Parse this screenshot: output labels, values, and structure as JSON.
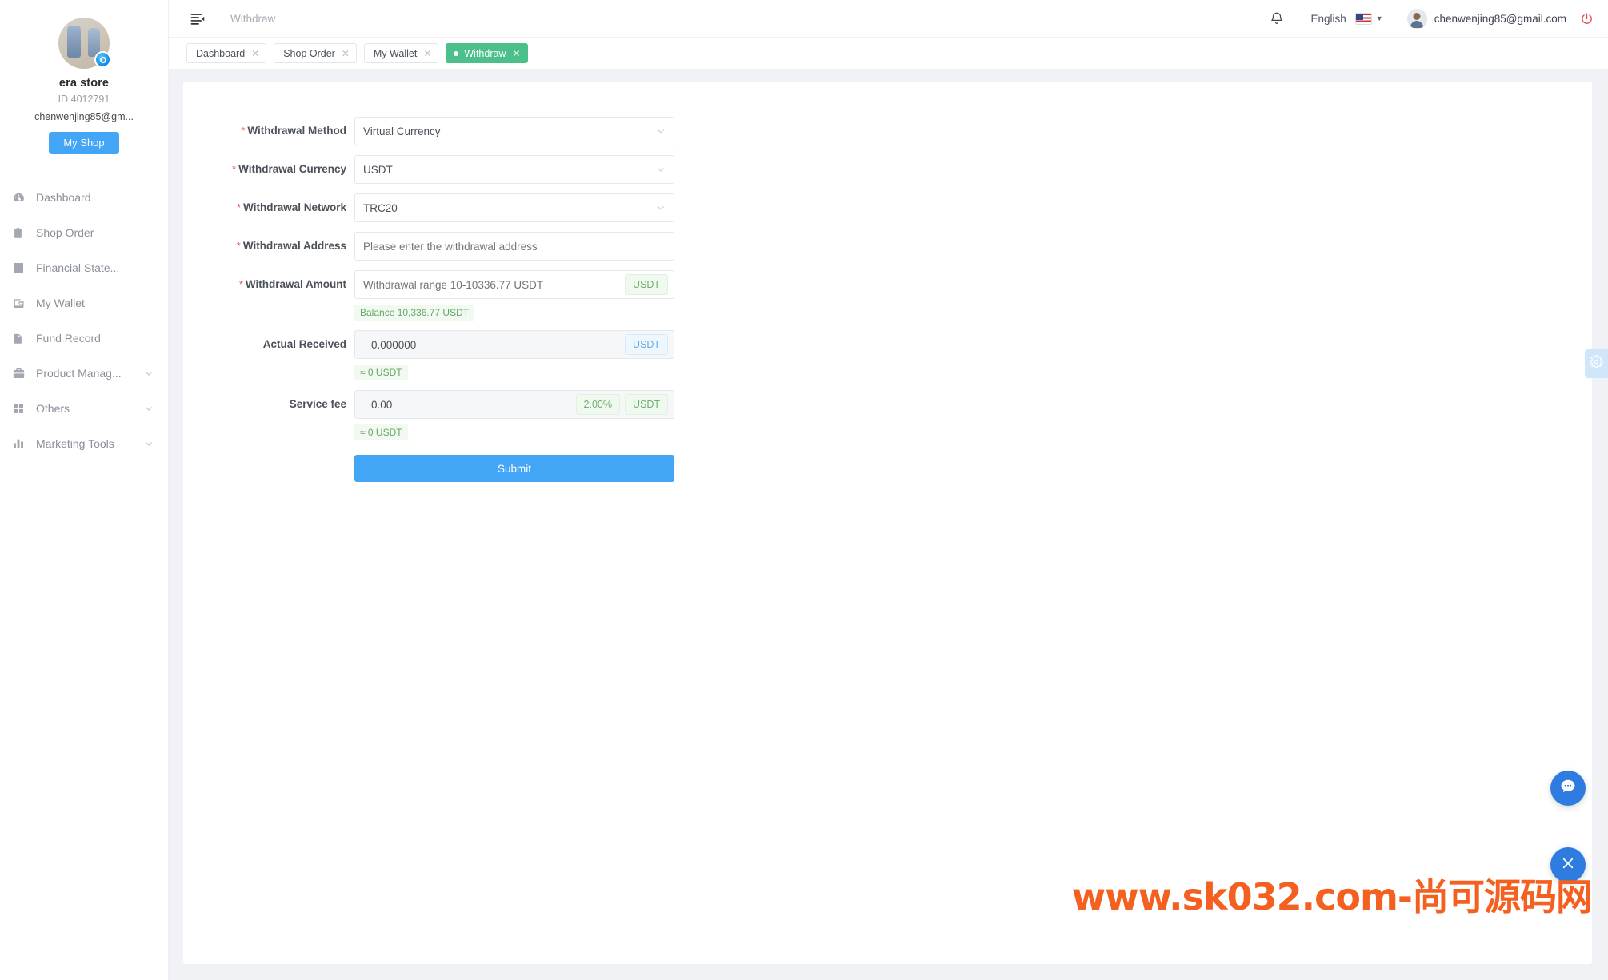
{
  "sidebar": {
    "profile": {
      "store_name": "era store",
      "store_id": "ID 4012791",
      "email": "chenwenjing85@gm...",
      "shop_button": "My Shop"
    },
    "items": [
      {
        "label": "Dashboard",
        "icon": "dashboard-icon",
        "caret": false
      },
      {
        "label": "Shop Order",
        "icon": "clipboard-icon",
        "caret": false
      },
      {
        "label": "Financial State...",
        "icon": "chart-report-icon",
        "caret": false
      },
      {
        "label": "My Wallet",
        "icon": "wallet-icon",
        "caret": false
      },
      {
        "label": "Fund Record",
        "icon": "document-icon",
        "caret": false
      },
      {
        "label": "Product Manag...",
        "icon": "briefcase-icon",
        "caret": true
      },
      {
        "label": "Others",
        "icon": "grid-icon",
        "caret": true
      },
      {
        "label": "Marketing Tools",
        "icon": "bar-chart-icon",
        "caret": true
      }
    ]
  },
  "topbar": {
    "collapse_icon": "collapse-menu-icon",
    "breadcrumb": "Withdraw",
    "bell_icon": "notification-bell-icon",
    "language": "English",
    "flag_icon": "us-flag-icon",
    "user_email": "chenwenjing85@gmail.com",
    "power_icon": "power-logout-icon"
  },
  "tabs": [
    {
      "label": "Dashboard",
      "active": false
    },
    {
      "label": "Shop Order",
      "active": false
    },
    {
      "label": "My Wallet",
      "active": false
    },
    {
      "label": "Withdraw",
      "active": true
    }
  ],
  "form": {
    "method": {
      "label": "Withdrawal Method",
      "value": "Virtual Currency",
      "required": true
    },
    "currency": {
      "label": "Withdrawal Currency",
      "value": "USDT",
      "required": true
    },
    "network": {
      "label": "Withdrawal Network",
      "value": "TRC20",
      "required": true
    },
    "address": {
      "label": "Withdrawal Address",
      "value": "",
      "placeholder": "Please enter the withdrawal address",
      "required": true
    },
    "amount": {
      "label": "Withdrawal Amount",
      "value": "",
      "placeholder": "Withdrawal range 10-10336.77 USDT",
      "suffix": "USDT",
      "hint": "Balance 10,336.77 USDT",
      "required": true
    },
    "actual_received": {
      "label": "Actual Received",
      "value": "0.000000",
      "suffix": "USDT",
      "hint": "≈ 0 USDT",
      "required": false
    },
    "service_fee": {
      "label": "Service fee",
      "value": "0.00",
      "rate": "2.00%",
      "suffix": "USDT",
      "hint": "≈ 0 USDT",
      "required": false
    },
    "submit_label": "Submit"
  },
  "widgets": {
    "settings_tab_icon": "gear-icon",
    "chat_fab_icon": "chat-bubble-icon",
    "close_fab_icon": "close-x-icon"
  },
  "watermark": "www.sk032.com-尚可源码网",
  "colors": {
    "accent_blue": "#42a5f5",
    "tab_green": "#4bc08a",
    "required_red": "#e8535e",
    "hint_green": "#63a763",
    "watermark_orange": "#f4601f"
  }
}
